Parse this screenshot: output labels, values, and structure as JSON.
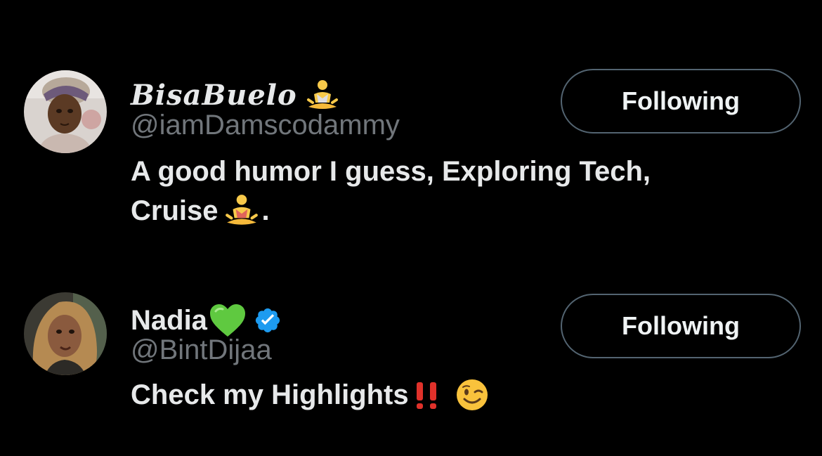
{
  "users": [
    {
      "display_name": "BisaBuelo",
      "name_emoji": "person-in-lotus-position-emoji",
      "handle": "@iamDamscodammy",
      "bio_line1": "A good humor I guess, Exploring Tech,",
      "bio_line2_prefix": "Cruise",
      "bio_line2_emoji": "person-in-lotus-position-emoji",
      "bio_line2_suffix": ".",
      "follow_label": "Following"
    },
    {
      "display_name": "Nadia",
      "name_emoji": "green-heart-emoji",
      "verified_badge": "verified-badge-icon",
      "handle": "@BintDijaa",
      "bio_prefix": "Check my Highlights",
      "bio_emojis": [
        "double-exclamation-emoji",
        "winking-face-emoji"
      ],
      "follow_label": "Following"
    }
  ],
  "colors": {
    "background": "#000000",
    "primary_text": "#e7e9ea",
    "secondary_text": "#71767b",
    "button_border": "#536471",
    "verified_blue": "#1d9bf0",
    "green_heart": "#5fc940"
  }
}
